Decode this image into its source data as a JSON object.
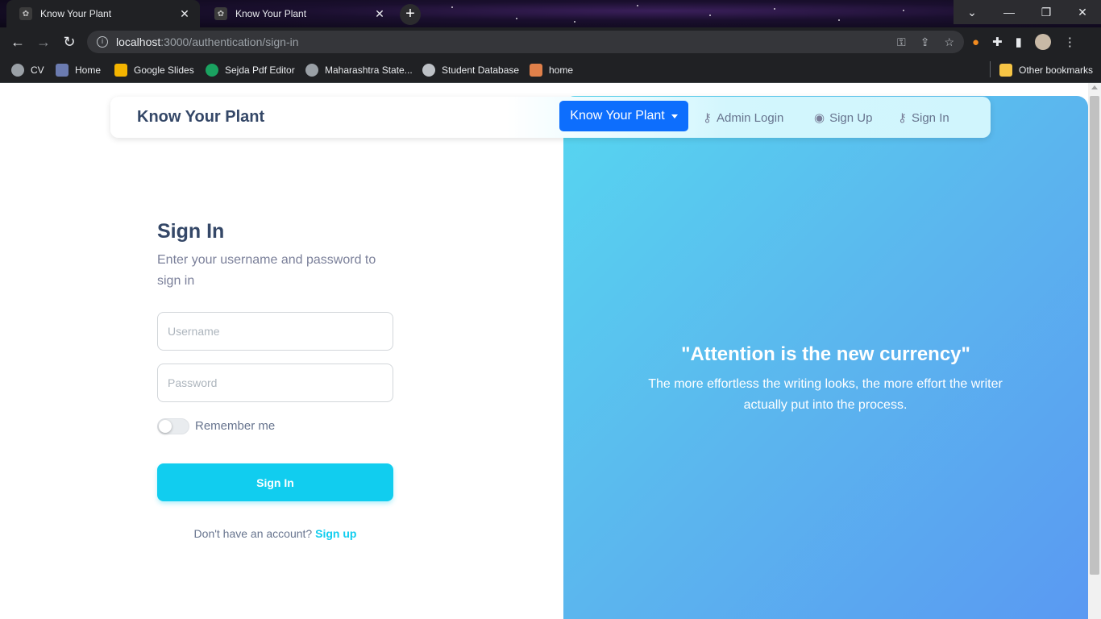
{
  "browser": {
    "tabs": [
      {
        "title": "Know Your Plant",
        "active": true
      },
      {
        "title": "Know Your Plant",
        "active": false
      }
    ],
    "new_tab_label": "+",
    "address": {
      "host": "localhost",
      "path": ":3000/authentication/sign-in"
    },
    "bookmarks": [
      {
        "label": "CV",
        "icon": "globe-icon",
        "color": "#9aa0a6"
      },
      {
        "label": "Home",
        "icon": "city-icon",
        "color": "#6b7bb0"
      },
      {
        "label": "Google Slides",
        "icon": "slides-icon",
        "color": "#f4b400"
      },
      {
        "label": "Sejda Pdf Editor",
        "icon": "sejda-icon",
        "color": "#1aa260"
      },
      {
        "label": "Maharashtra State...",
        "icon": "globe-icon",
        "color": "#9aa0a6"
      },
      {
        "label": "Student Database",
        "icon": "database-icon",
        "color": "#bdc1c6"
      },
      {
        "label": "home",
        "icon": "flag-icon",
        "color": "#e0804a"
      }
    ],
    "other_bookmarks": "Other bookmarks"
  },
  "navbar": {
    "brand": "Know Your Plant",
    "dropdown": "Know Your Plant",
    "links": [
      {
        "label": "Admin Login",
        "icon": "key-icon"
      },
      {
        "label": "Sign Up",
        "icon": "user-circle-icon"
      },
      {
        "label": "Sign In",
        "icon": "key-icon"
      }
    ]
  },
  "form": {
    "title": "Sign In",
    "subtitle": "Enter your username and password to sign in",
    "username_placeholder": "Username",
    "password_placeholder": "Password",
    "remember_label": "Remember me",
    "remember_on": false,
    "submit_label": "Sign In",
    "footer_text": "Don't have an account?",
    "footer_link": "Sign up"
  },
  "hero": {
    "quote": "\"Attention is the new currency\"",
    "body": "The more effortless the writing looks, the more effort the writer actually put into the process."
  },
  "colors": {
    "accent": "#11cdef",
    "primary": "#0d6efd",
    "heading": "#344767"
  }
}
